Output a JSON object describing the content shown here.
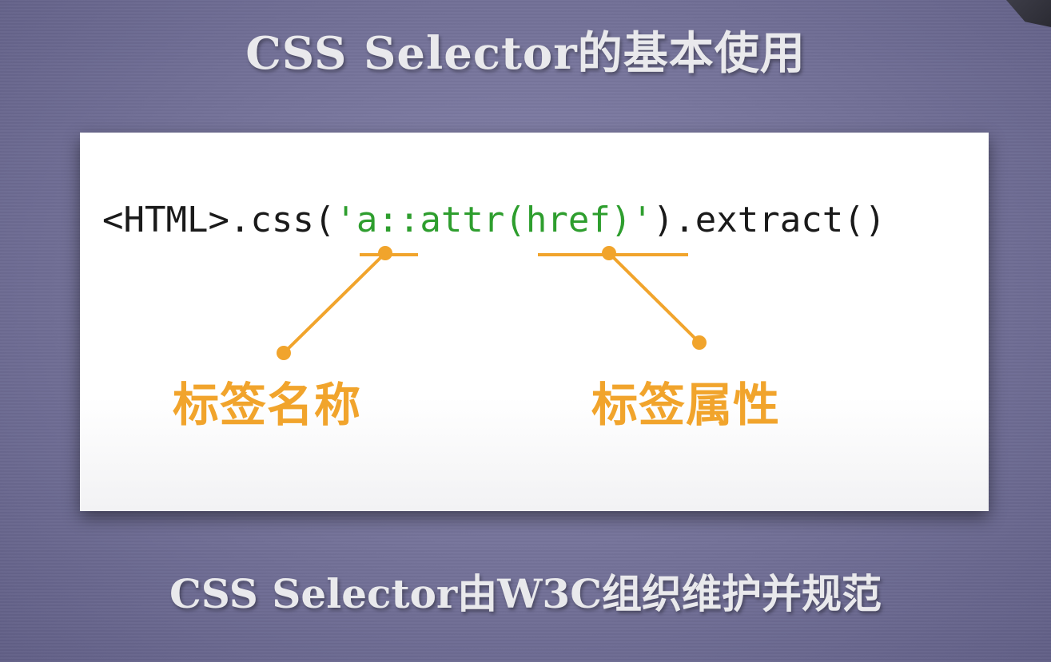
{
  "title": "CSS Selector的基本使用",
  "code": {
    "prefix": "<HTML>.css(",
    "quote_open": "'",
    "selector_tag": "a",
    "selector_sep": "::",
    "selector_func": "attr(",
    "selector_attr": "href",
    "selector_close": ")",
    "quote_close": "'",
    "suffix": ").extract()"
  },
  "annotations": {
    "tag_name": "标签名称",
    "tag_attribute": "标签属性"
  },
  "footer": "CSS Selector由W3C组织维护并规范",
  "colors": {
    "background": "#77759c",
    "card": "#ffffff",
    "code_text": "#1a1a1a",
    "selector_green": "#2e9e2e",
    "annotation_orange": "#f1a42c",
    "heading_text": "#e9e9ec"
  }
}
